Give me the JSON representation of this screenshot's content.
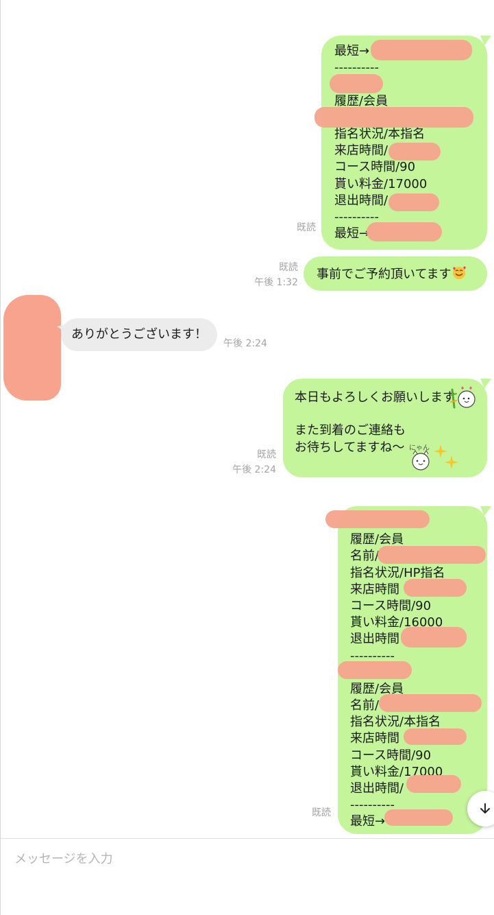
{
  "colors": {
    "bubble_sent": "#c5f59b",
    "bubble_received": "#ececec",
    "meta_text": "#a3a3a3",
    "redaction": "#f7a38d"
  },
  "messages": {
    "m1": {
      "lines": [
        "最短→",
        "----------",
        "",
        "履歴/会員",
        "",
        "指名状況/本指名",
        "来店時間/",
        "コース時間/90",
        "貰い料金/17000",
        "退出時間/",
        "----------",
        "最短→"
      ],
      "read": "既読",
      "time": ""
    },
    "m2": {
      "text": "事前でご予約頂いてます",
      "emoji": "smiling-hearts-emoji",
      "read": "既読",
      "time": "午後 1:32"
    },
    "m3": {
      "text": "ありがとうございます！",
      "time": "午後 2:24"
    },
    "m4": {
      "lines": [
        "本日もよろしくお願いします",
        "",
        "また到着のご連絡も",
        "お待ちしてますね〜"
      ],
      "stickers": [
        "yoroshiku-cat-sticker",
        "nyan-cat-sticker",
        "sparkle-emoji"
      ],
      "read": "既読",
      "time": "午後 2:24"
    },
    "m5": {
      "lines": [
        "",
        "履歴/会員",
        "名前/",
        "指名状況/HP指名",
        "来店時間",
        "コース時間/90",
        "貰い料金/16000",
        "退出時間",
        "----------",
        "",
        "履歴/会員",
        "名前/",
        "指名状況/本指名",
        "来店時間",
        "コース時間/90",
        "貰い料金/17000",
        "退出時間/",
        "----------",
        "最短→"
      ],
      "read": "既読"
    }
  },
  "composer": {
    "placeholder": "メッセージを入力"
  },
  "scroll_down_icon": "arrow-down-icon"
}
